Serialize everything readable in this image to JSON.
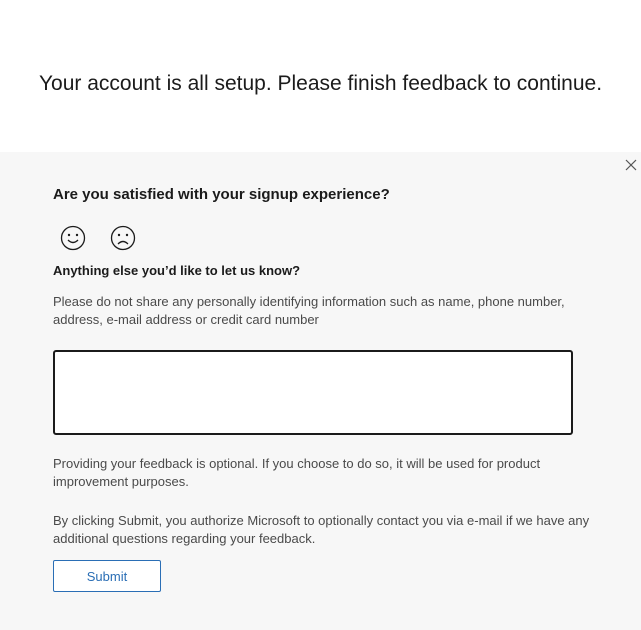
{
  "headline": "Your account is all setup. Please finish feedback to continue.",
  "feedback": {
    "satisfaction_question": "Are you satisfied with your signup experience?",
    "smileys": [
      {
        "name": "happy-face-icon",
        "glyph": "☺"
      },
      {
        "name": "sad-face-icon",
        "glyph": "☹"
      }
    ],
    "comment_question": "Anything else you’d like to let us know?",
    "privacy_note": "Please do not share any personally identifying information such as name, phone number, address, e-mail address or credit card number",
    "comment_value": "",
    "optional_note": "Providing your feedback is optional. If you choose to do so, it will be used for product improvement purposes.",
    "authorization_note": "By clicking Submit, you authorize Microsoft to optionally contact you via e-mail if we have any additional questions regarding your feedback.",
    "submit_label": "Submit",
    "close_icon": "close-icon"
  },
  "colors": {
    "panel_background": "#f7f7f7",
    "accent": "#2a6eb5",
    "text": "#1b1b1b"
  }
}
